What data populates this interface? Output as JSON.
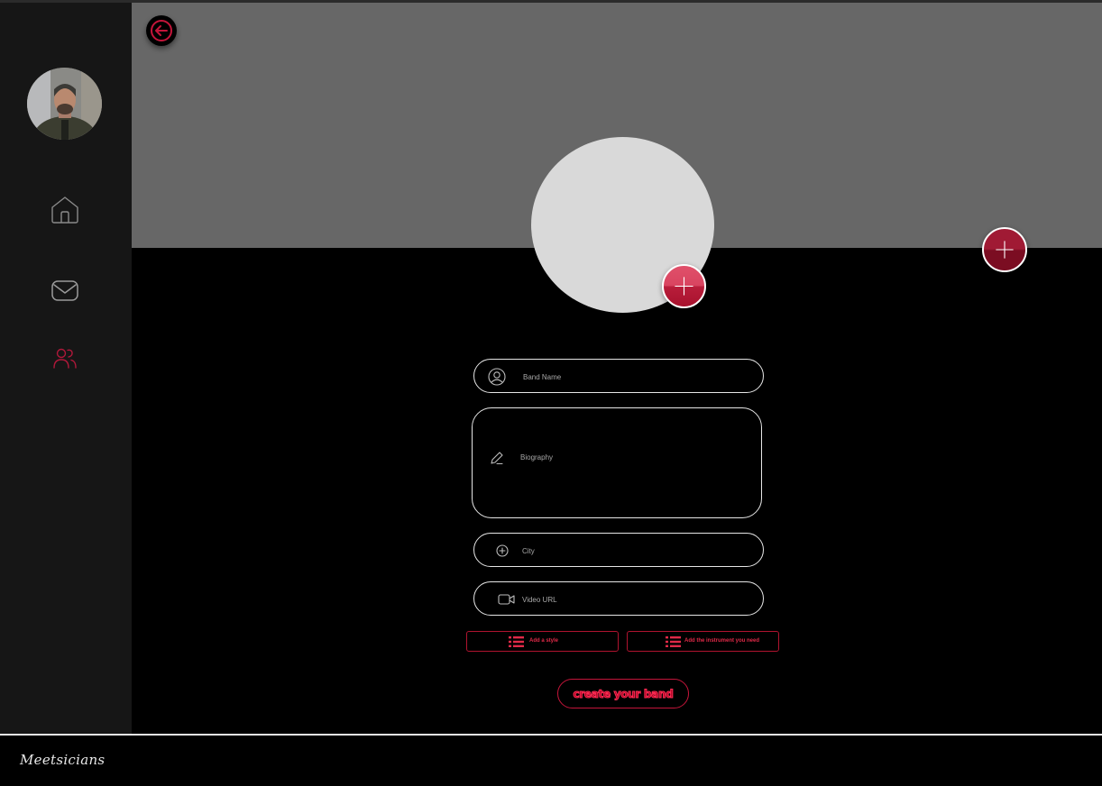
{
  "sidebar": {
    "nav": [
      {
        "icon": "home-icon"
      },
      {
        "icon": "mail-icon"
      },
      {
        "icon": "users-icon",
        "active": true
      }
    ]
  },
  "form": {
    "band_name": {
      "placeholder": "Band Name",
      "value": ""
    },
    "biography": {
      "placeholder": "Biography",
      "value": ""
    },
    "city": {
      "placeholder": "City",
      "value": ""
    },
    "video_url": {
      "placeholder": "Video URL",
      "value": ""
    },
    "add_style_label": "Add a style",
    "add_instrument_label": "Add the instrument you need",
    "submit_label": "create your band"
  },
  "footer": {
    "logo_text": "Meetsicians"
  },
  "colors": {
    "accent": "#c4153a",
    "sidebar_bg": "#161616",
    "banner_bg": "#676767",
    "page_bg": "#000000"
  }
}
